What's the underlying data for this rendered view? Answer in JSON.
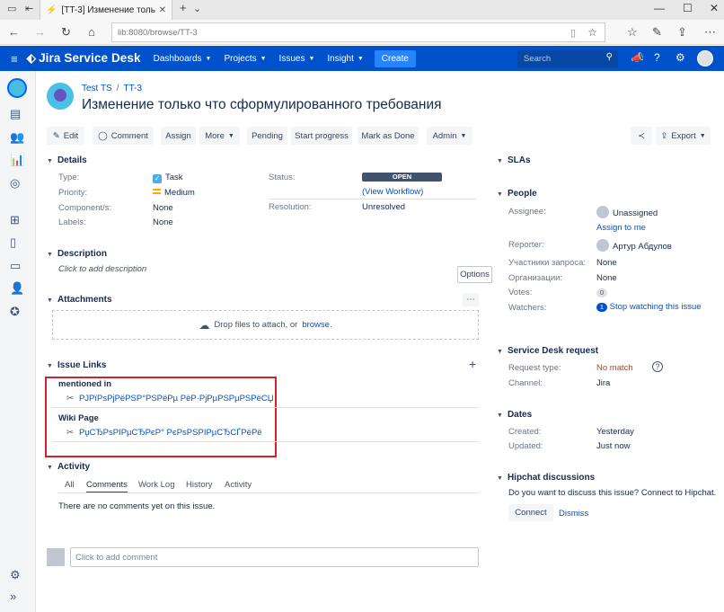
{
  "browser": {
    "tab_title": "[TT-3] Изменение толь",
    "url": "lib:8080/browse/TT-3"
  },
  "header": {
    "logo": "Jira Service Desk",
    "nav": [
      "Dashboards",
      "Projects",
      "Issues",
      "Insight"
    ],
    "create": "Create",
    "search_placeholder": "Search"
  },
  "breadcrumb": {
    "project": "Test TS",
    "issue": "TT-3"
  },
  "issue_title": "Изменение только что сформулированного требования",
  "toolbar": {
    "edit": "Edit",
    "comment": "Comment",
    "assign": "Assign",
    "more": "More",
    "pending": "Pending",
    "start_progress": "Start progress",
    "mark_done": "Mark as Done",
    "admin": "Admin",
    "export": "Export"
  },
  "details": {
    "heading": "Details",
    "type_label": "Type:",
    "type_value": "Task",
    "priority_label": "Priority:",
    "priority_value": "Medium",
    "components_label": "Component/s:",
    "components_value": "None",
    "labels_label": "Labels:",
    "labels_value": "None",
    "status_label": "Status:",
    "status_value": "OPEN",
    "view_workflow": "(View Workflow)",
    "resolution_label": "Resolution:",
    "resolution_value": "Unresolved"
  },
  "description": {
    "heading": "Description",
    "placeholder": "Click to add description",
    "options": "Options"
  },
  "attachments": {
    "heading": "Attachments",
    "drop_text": "Drop files to attach, or",
    "browse": "browse."
  },
  "issue_links": {
    "heading": "Issue Links",
    "groups": [
      {
        "type": "mentioned in",
        "link": "РЈРїРѕРјРёРЅР°РЅРёРµ РёР·РјРµРЅРµРЅРёСЏ"
      },
      {
        "type": "Wiki Page",
        "link": "РџСЂРѕРІРµСЂРєР° РєРѕРЅРІРµСЂСЃРёРё"
      }
    ]
  },
  "activity": {
    "heading": "Activity",
    "tabs": [
      "All",
      "Comments",
      "Work Log",
      "History",
      "Activity"
    ],
    "empty": "There are no comments yet on this issue.",
    "comment_placeholder": "Click to add comment"
  },
  "side": {
    "slas": "SLAs",
    "people": {
      "heading": "People",
      "assignee_label": "Assignee:",
      "assignee_value": "Unassigned",
      "assign_to_me": "Assign to me",
      "reporter_label": "Reporter:",
      "reporter_value": "Артур Абдулов",
      "participants_label": "Участники запроса:",
      "participants_value": "None",
      "orgs_label": "Организации:",
      "orgs_value": "None",
      "votes_label": "Votes:",
      "votes_value": "0",
      "watchers_label": "Watchers:",
      "watchers_count": "1",
      "watch_link": "Stop watching this issue"
    },
    "sd": {
      "heading": "Service Desk request",
      "request_type_label": "Request type:",
      "request_type_value": "No match",
      "channel_label": "Channel:",
      "channel_value": "Jira"
    },
    "dates": {
      "heading": "Dates",
      "created_label": "Created:",
      "created_value": "Yesterday",
      "updated_label": "Updated:",
      "updated_value": "Just now"
    },
    "hipchat": {
      "heading": "Hipchat discussions",
      "text": "Do you want to discuss this issue? Connect to Hipchat.",
      "connect": "Connect",
      "dismiss": "Dismiss"
    }
  },
  "colors": {
    "brand": "#0052cc",
    "status": "#42526e",
    "highlight": "#d1232a",
    "no_match": "#de350b"
  }
}
